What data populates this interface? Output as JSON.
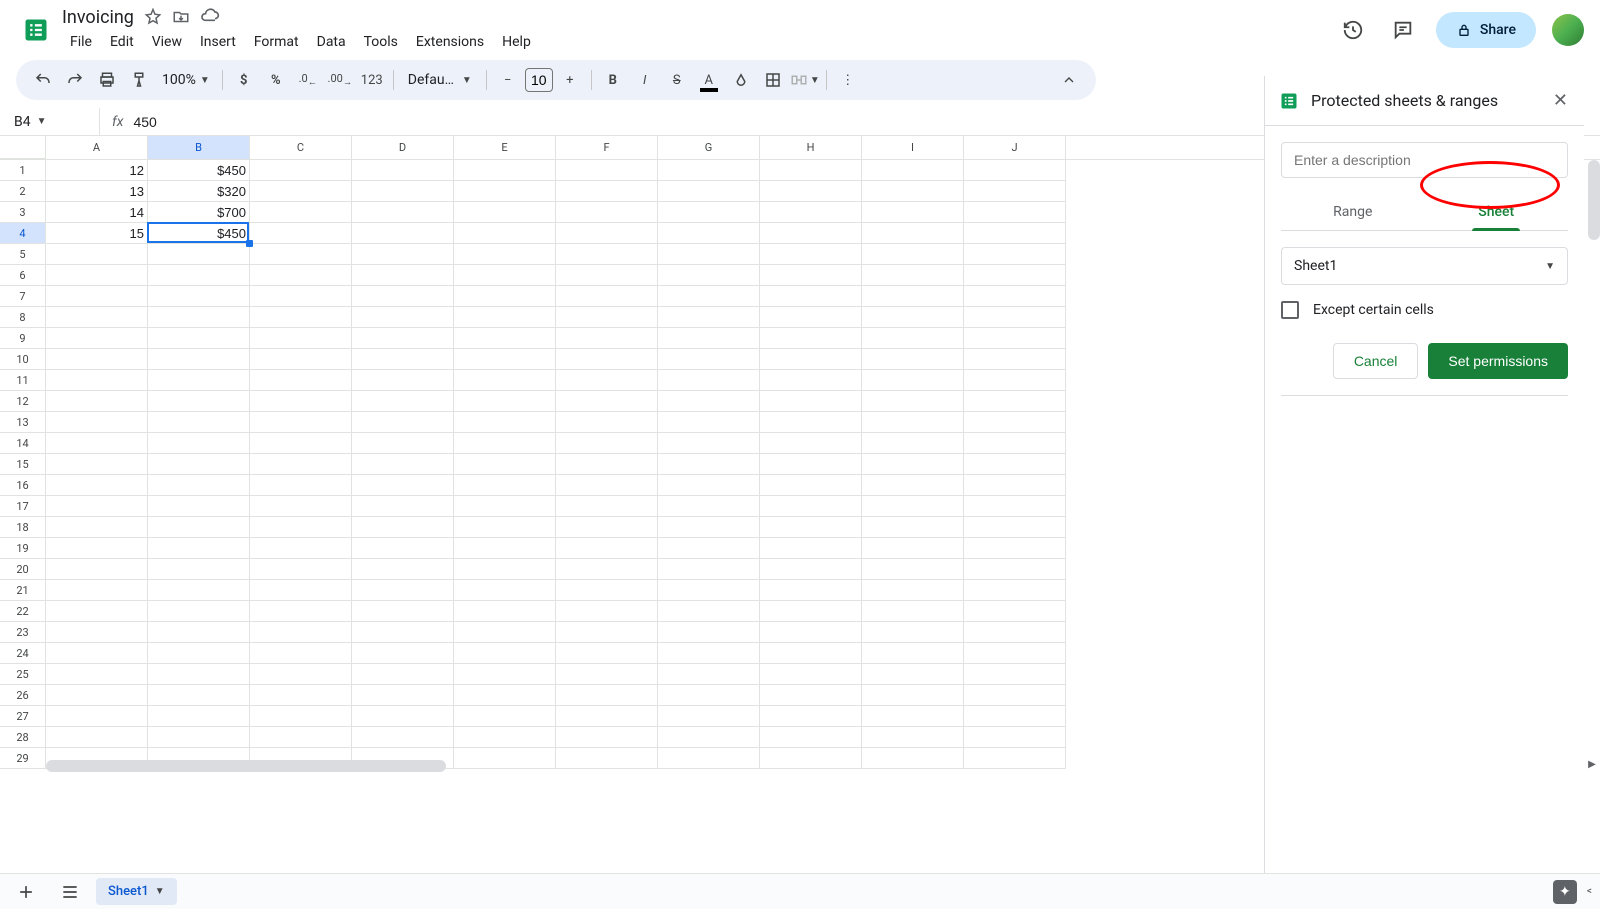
{
  "doc": {
    "title": "Invoicing"
  },
  "menu": {
    "items": [
      "File",
      "Edit",
      "View",
      "Insert",
      "Format",
      "Data",
      "Tools",
      "Extensions",
      "Help"
    ]
  },
  "share": {
    "label": "Share"
  },
  "toolbar": {
    "zoom": "100%",
    "font": "Defaul…",
    "fontsize": "10",
    "formatLabel": "123"
  },
  "namebox": {
    "value": "B4"
  },
  "formula": {
    "value": "450"
  },
  "columns": [
    "A",
    "B",
    "C",
    "D",
    "E",
    "F",
    "G",
    "H",
    "I",
    "J"
  ],
  "rows": 29,
  "selectedCell": {
    "col": 1,
    "row": 3
  },
  "cellData": [
    [
      "12",
      "$450",
      "",
      "",
      "",
      "",
      "",
      "",
      "",
      ""
    ],
    [
      "13",
      "$320",
      "",
      "",
      "",
      "",
      "",
      "",
      "",
      ""
    ],
    [
      "14",
      "$700",
      "",
      "",
      "",
      "",
      "",
      "",
      "",
      ""
    ],
    [
      "15",
      "$450",
      "",
      "",
      "",
      "",
      "",
      "",
      "",
      ""
    ]
  ],
  "sidebar": {
    "title": "Protected sheets & ranges",
    "descPlaceholder": "Enter a description",
    "tabs": {
      "range": "Range",
      "sheet": "Sheet"
    },
    "activeTab": "sheet",
    "sheetSelect": "Sheet1",
    "exceptLabel": "Except certain cells",
    "cancel": "Cancel",
    "setPerm": "Set permissions"
  },
  "sheetTab": {
    "name": "Sheet1"
  }
}
